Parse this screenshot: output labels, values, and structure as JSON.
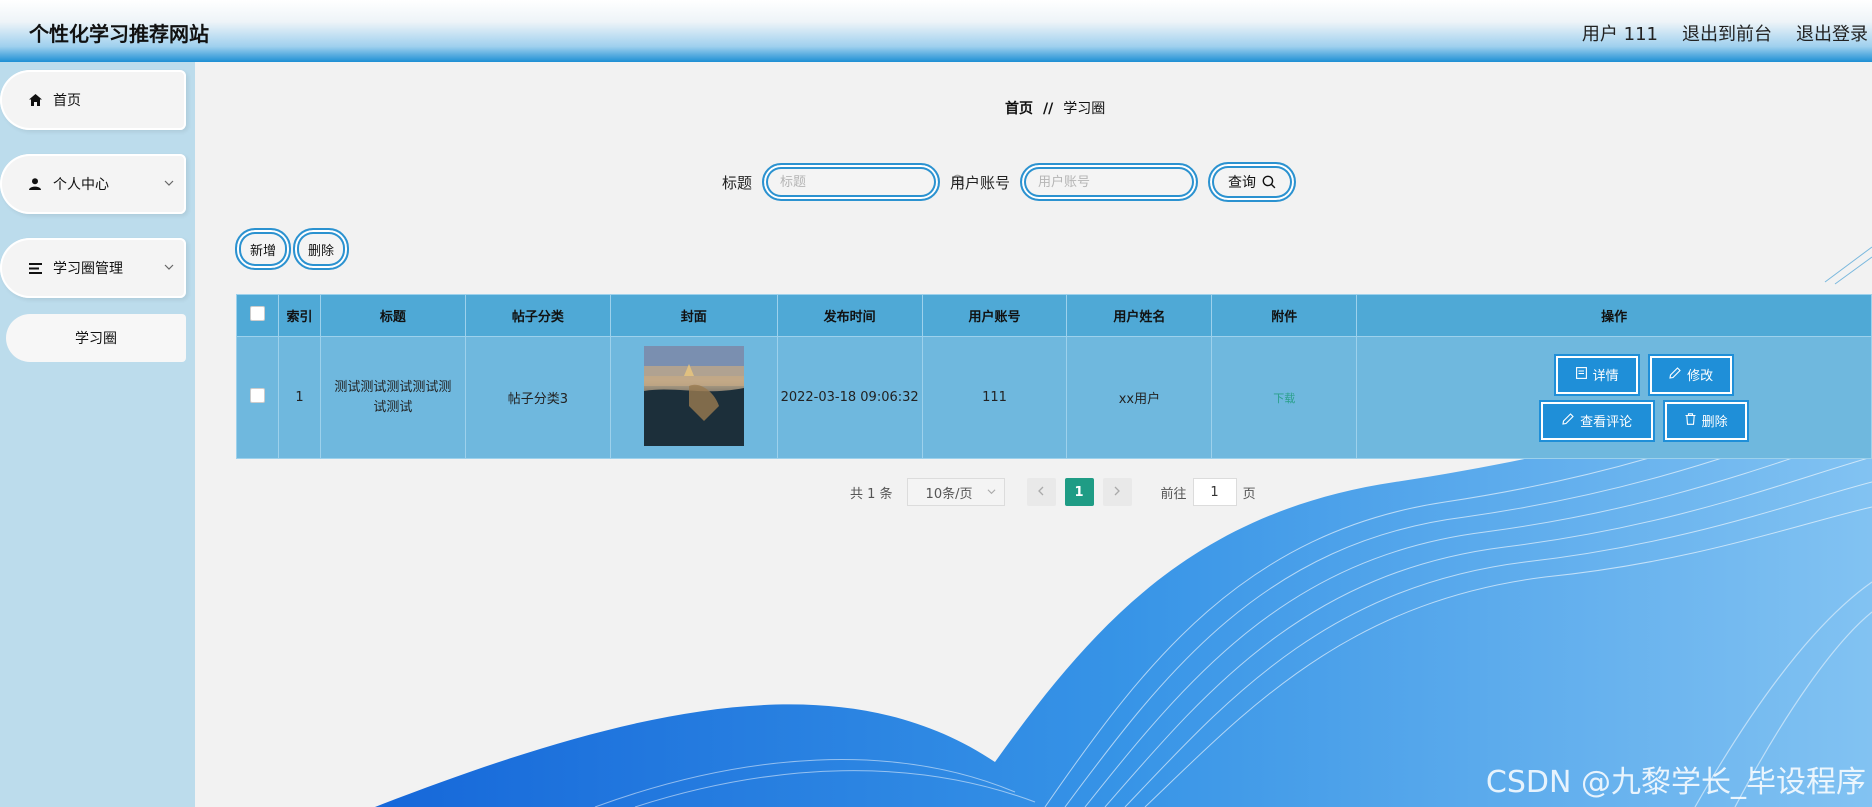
{
  "header": {
    "brand": "个性化学习推荐网站",
    "user": "用户 111",
    "to_front": "退出到前台",
    "logout": "退出登录"
  },
  "sidebar": {
    "items": [
      {
        "label": "首页",
        "icon": "home-icon"
      },
      {
        "label": "个人中心",
        "icon": "user-icon"
      },
      {
        "label": "学习圈管理",
        "icon": "list-icon"
      }
    ],
    "sub_items": [
      "学习圈"
    ]
  },
  "breadcrumb": {
    "home": "首页",
    "sep": "//",
    "current": "学习圈"
  },
  "search": {
    "title_label": "标题",
    "title_placeholder": "标题",
    "account_label": "用户账号",
    "account_placeholder": "用户账号",
    "query_button": "查询"
  },
  "actions": {
    "add": "新增",
    "delete": "删除"
  },
  "table": {
    "headers": [
      "索引",
      "标题",
      "帖子分类",
      "封面",
      "发布时间",
      "用户账号",
      "用户姓名",
      "附件",
      "操作"
    ],
    "rows": [
      {
        "index": "1",
        "title": "测试测试测试测试测试测试",
        "category": "帖子分类3",
        "publish_time": "2022-03-18 09:06:32",
        "account": "111",
        "name": "xx用户",
        "attachment": "下载",
        "ops": {
          "detail": "详情",
          "edit": "修改",
          "comments": "查看评论",
          "delete": "删除"
        }
      }
    ]
  },
  "pagination": {
    "total": "共 1 条",
    "page_size": "10条/页",
    "current": "1",
    "goto_label": "前往",
    "goto_value": "1",
    "page_suffix": "页"
  },
  "watermark": "CSDN @九黎学长_毕设程序",
  "colors": {
    "accent": "#1f8fd8",
    "table_header": "#4fa9d6",
    "table_row": "#6fb8de",
    "active_page": "#1f9c85"
  }
}
